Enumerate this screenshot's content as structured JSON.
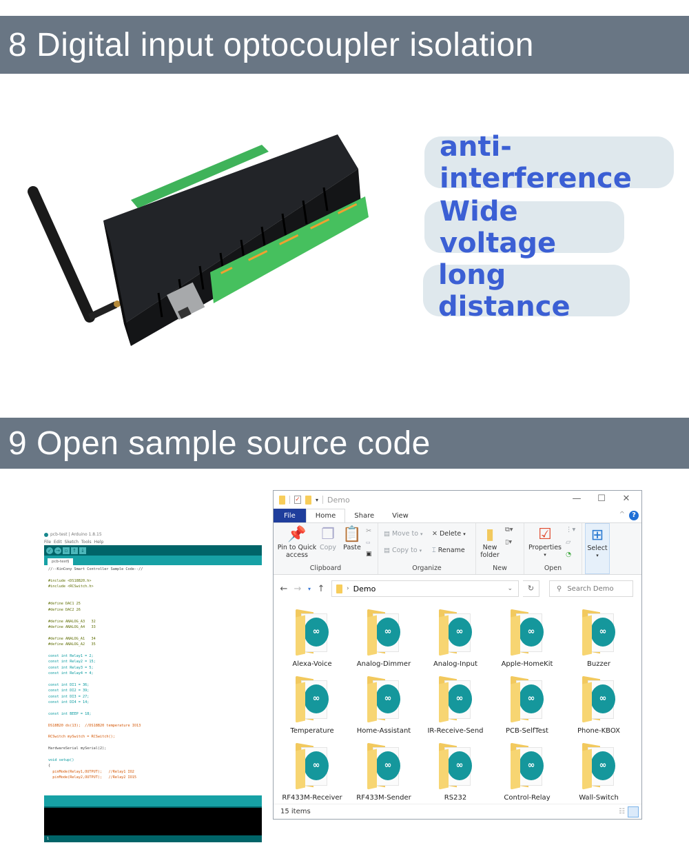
{
  "section8": {
    "title": "8 Digital input optocoupler isolation",
    "features": [
      "anti-interference",
      "Wide voltage",
      "long distance"
    ]
  },
  "section9": {
    "title": "9 Open sample source code"
  },
  "arduino": {
    "window_title": "pcb-test | Arduino 1.8.15",
    "menu": [
      "File",
      "Edit",
      "Sketch",
      "Tools",
      "Help"
    ],
    "toolbar": [
      "verify-icon",
      "upload-icon",
      "new-icon",
      "open-icon",
      "save-icon"
    ],
    "tab": "pcb-test§",
    "code": [
      "//--KinCony Smart Controller Sample Code--//",
      "",
      "#include <DS18B20.h>",
      "#include <RCSwitch.h>",
      "",
      "",
      "#define DAC1 25",
      "#define DAC2 26",
      "",
      "#define ANALOG_A3   32",
      "#define ANALOG_A4   33",
      "",
      "#define ANALOG_A1   34",
      "#define ANALOG_A2   35",
      "",
      "const int Relay1 = 2;",
      "const int Relay2 = 15;",
      "const int Relay3 = 5;",
      "const int Relay4 = 4;",
      "",
      "const int DI1 = 36;",
      "const int DI2 = 39;",
      "const int DI3 = 27;",
      "const int DI4 = 14;",
      "",
      "const int BEEP = 18;",
      "",
      "DS18B20 ds(13);  //DS18B20 temperature IO13",
      "",
      "RCSwitch mySwitch = RCSwitch();",
      "",
      "HardwareSerial mySerial(2);",
      "",
      "void setup()",
      "{",
      "  pinMode(Relay1,OUTPUT);   //Relay1 IO2",
      "  pinMode(Relay2,OUTPUT);   //Relay2 IO15"
    ],
    "status_line": "1"
  },
  "explorer": {
    "title": "Demo",
    "window_controls": [
      "minimize",
      "maximize",
      "close"
    ],
    "ribbon_tabs": [
      "File",
      "Home",
      "Share",
      "View"
    ],
    "active_tab": "Home",
    "ribbon": {
      "clipboard": {
        "label": "Clipboard",
        "pin": "Pin to Quick access",
        "copy": "Copy",
        "paste": "Paste"
      },
      "organize": {
        "label": "Organize",
        "move_to": "Move to",
        "copy_to": "Copy to",
        "delete": "Delete",
        "rename": "Rename"
      },
      "new": {
        "label": "New",
        "new_folder": "New folder"
      },
      "open": {
        "label": "Open",
        "properties": "Properties"
      },
      "select": {
        "label": "Select"
      }
    },
    "address": {
      "path": "Demo",
      "search_placeholder": "Search Demo"
    },
    "items": [
      "Alexa-Voice",
      "Analog-Dimmer",
      "Analog-Input",
      "Apple-HomeKit",
      "Buzzer",
      "Temperature",
      "Home-Assistant",
      "IR-Receive-Send",
      "PCB-SelfTest",
      "Phone-KBOX",
      "RF433M-Receiver",
      "RF433M-Sender",
      "RS232",
      "Control-Relay",
      "Wall-Switch"
    ],
    "status": "15 items"
  },
  "colors": {
    "banner": "#697684",
    "pill_bg": "#dfe8ed",
    "pill_text": "#3b5fd4",
    "arduino_teal": "#17a1a5",
    "arduino_dark": "#006468",
    "explorer_file_tab": "#1f3e9c"
  }
}
